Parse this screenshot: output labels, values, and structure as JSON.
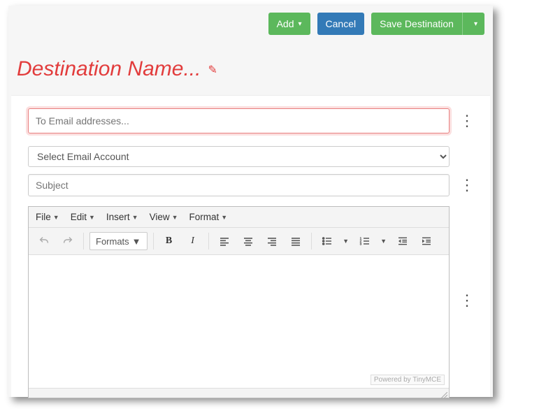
{
  "toolbar": {
    "add_label": "Add",
    "cancel_label": "Cancel",
    "save_label": "Save Destination"
  },
  "title": "Destination Name...",
  "to": {
    "placeholder": "To Email addresses...",
    "value": ""
  },
  "account_select": {
    "placeholder": "Select Email Account",
    "options": []
  },
  "subject": {
    "placeholder": "Subject",
    "value": ""
  },
  "editor": {
    "menus": {
      "file": "File",
      "edit": "Edit",
      "insert": "Insert",
      "view": "View",
      "format": "Format"
    },
    "formats_label": "Formats",
    "powered_by": "Powered by TinyMCE",
    "body": ""
  }
}
